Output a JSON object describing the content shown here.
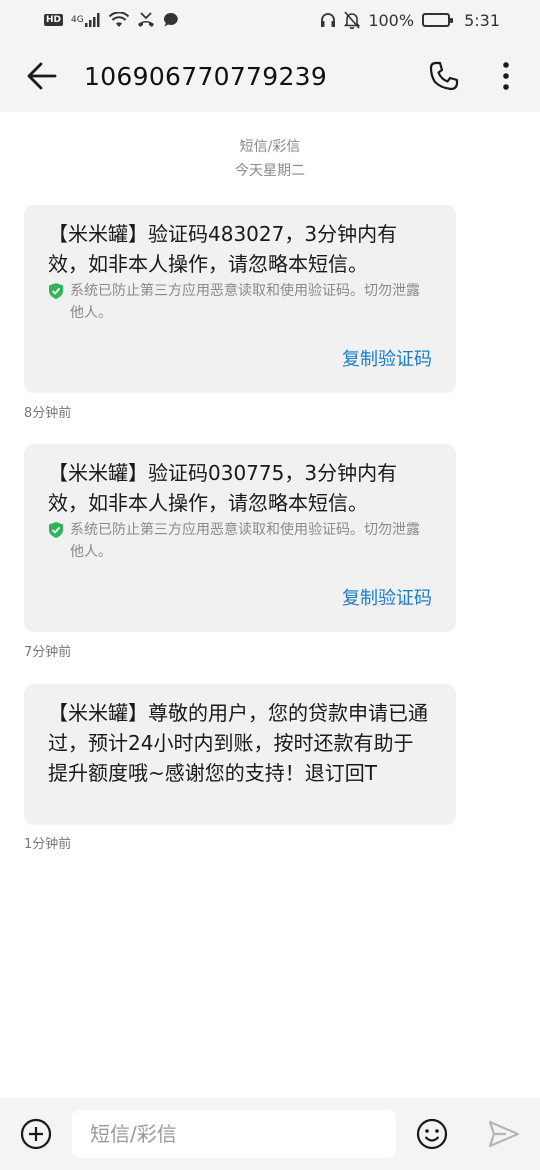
{
  "status_bar": {
    "signal_label": "4G",
    "battery_text": "100%",
    "time": "5:31",
    "hd_label": "HD"
  },
  "app_bar": {
    "title": "106906770779239"
  },
  "thread": {
    "type_label": "短信/彩信",
    "date_label": "今天星期二"
  },
  "messages": [
    {
      "text": "【米米罐】验证码483027，3分钟内有效，如非本人操作，请忽略本短信。",
      "notice": "系统已防止第三方应用恶意读取和使用验证码。切勿泄露他人。",
      "copy_label": "复制验证码",
      "time": "8分钟前"
    },
    {
      "text": "【米米罐】验证码030775，3分钟内有效，如非本人操作，请忽略本短信。",
      "notice": "系统已防止第三方应用恶意读取和使用验证码。切勿泄露他人。",
      "copy_label": "复制验证码",
      "time": "7分钟前"
    },
    {
      "text": "【米米罐】尊敬的用户，您的贷款申请已通过，预计24小时内到账，按时还款有助于提升额度哦~感谢您的支持！退订回T",
      "time": "1分钟前"
    }
  ],
  "input_bar": {
    "placeholder": "短信/彩信",
    "value": ""
  },
  "icons": {
    "back": "arrow-left-icon",
    "call": "phone-icon",
    "more": "more-vertical-icon",
    "add": "plus-circle-icon",
    "emoji": "smiley-icon",
    "send": "send-icon",
    "shield": "shield-check-icon"
  },
  "colors": {
    "bar_background": "#f4f4f4",
    "bubble_background": "#f1f1f1",
    "link": "#1b7cc8",
    "shield": "#2fb45a",
    "muted_text": "#8a8a8a"
  }
}
